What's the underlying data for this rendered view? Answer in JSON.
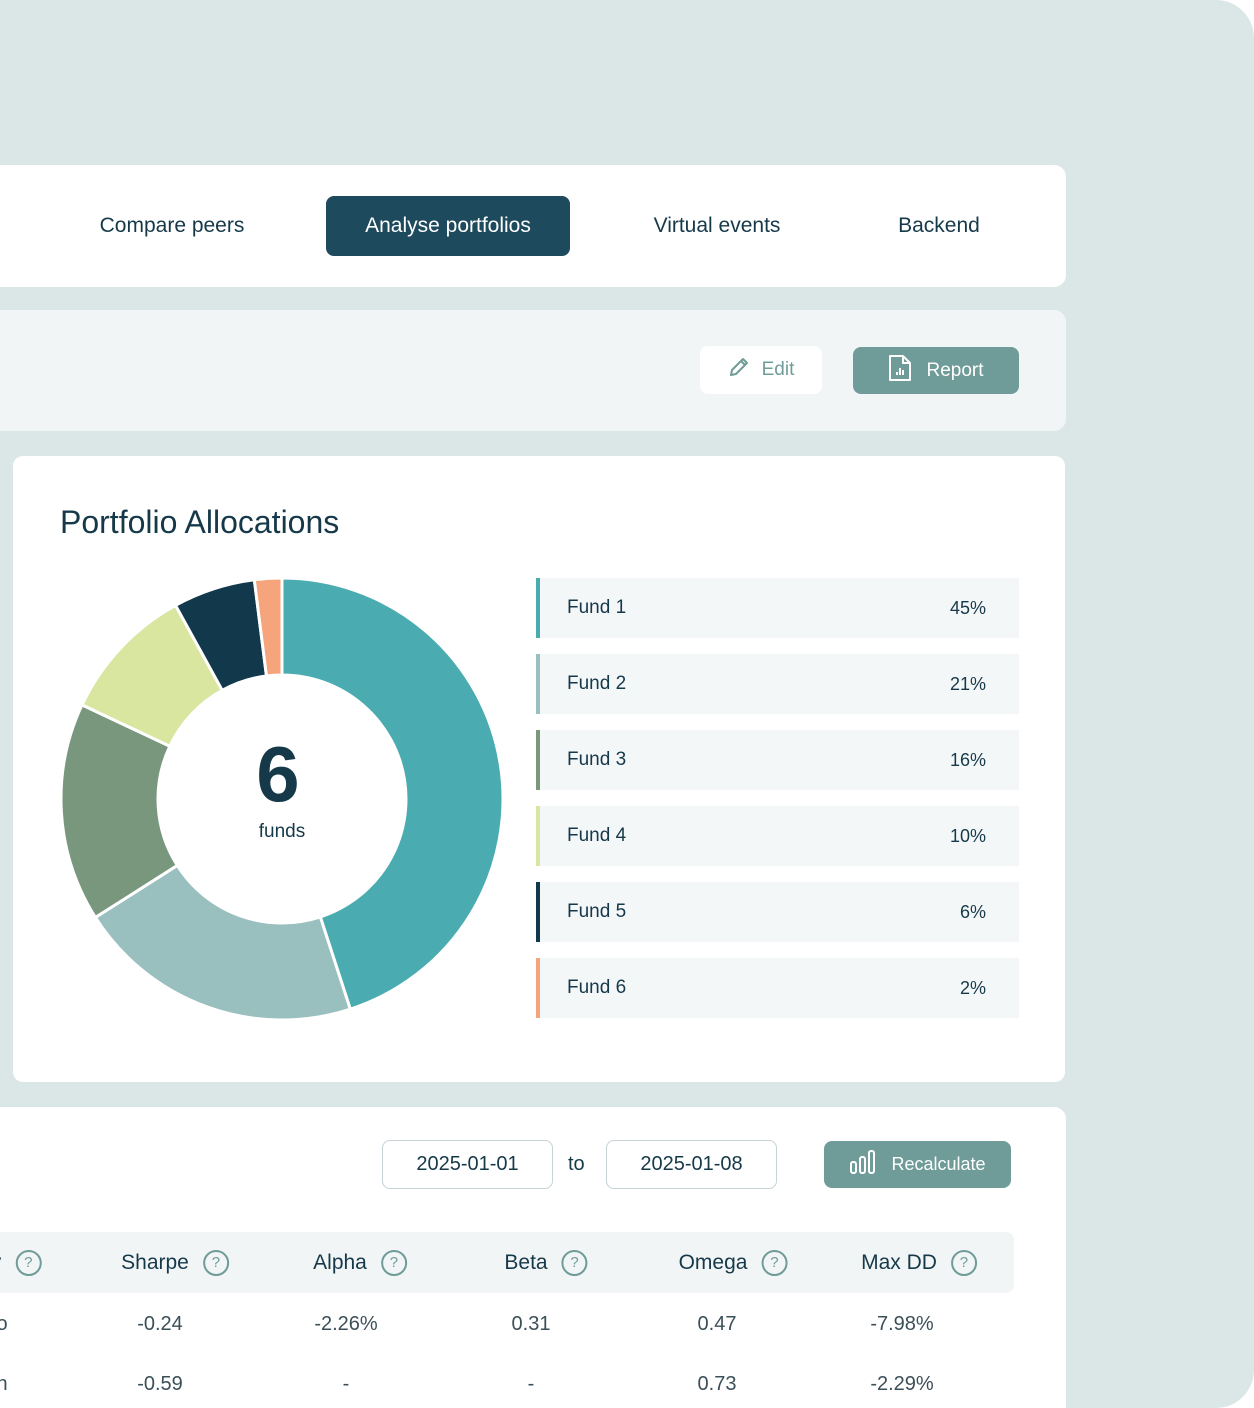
{
  "tabs": [
    {
      "label": "Compare peers",
      "active": false
    },
    {
      "label": "Analyse portfolios",
      "active": true
    },
    {
      "label": "Virtual events",
      "active": false
    },
    {
      "label": "Backend",
      "active": false
    }
  ],
  "toolbar": {
    "edit_label": "Edit",
    "report_label": "Report"
  },
  "allocations": {
    "title": "Portfolio Allocations",
    "center_count": "6",
    "center_label": "funds",
    "funds": [
      {
        "name": "Fund 1",
        "percent_label": "45%",
        "value": 45,
        "color": "#4aabb0"
      },
      {
        "name": "Fund 2",
        "percent_label": "21%",
        "value": 21,
        "color": "#9abfbf"
      },
      {
        "name": "Fund 3",
        "percent_label": "16%",
        "value": 16,
        "color": "#78977d"
      },
      {
        "name": "Fund 4",
        "percent_label": "10%",
        "value": 10,
        "color": "#d8e6a0"
      },
      {
        "name": "Fund 5",
        "percent_label": "6%",
        "value": 6,
        "color": "#11384b"
      },
      {
        "name": "Fund 6",
        "percent_label": "2%",
        "value": 2,
        "color": "#f5a47c"
      }
    ]
  },
  "metrics": {
    "date_from": "2025-01-01",
    "to_label": "to",
    "date_to": "2025-01-08",
    "recalculate_label": "Recalculate",
    "help_glyph": "?",
    "columns": [
      "y",
      "Sharpe",
      "Alpha",
      "Beta",
      "Omega",
      "Max DD"
    ],
    "rows": [
      [
        "o",
        "-0.24",
        "-2.26%",
        "0.31",
        "0.47",
        "-7.98%"
      ],
      [
        "n",
        "-0.59",
        "-",
        "-",
        "0.73",
        "-2.29%"
      ]
    ]
  }
}
